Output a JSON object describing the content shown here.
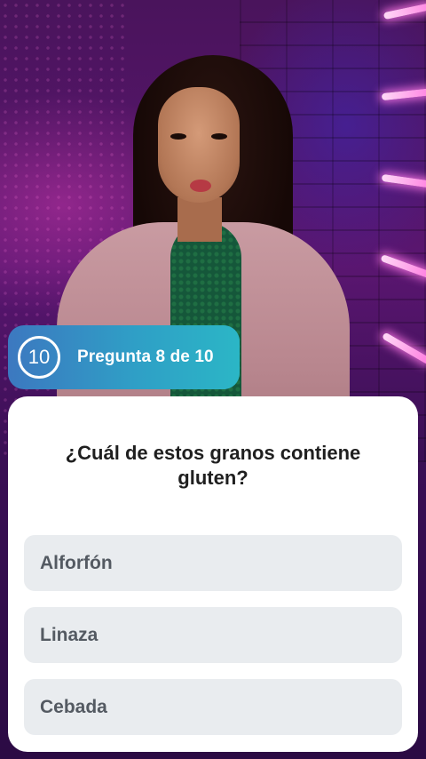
{
  "quiz": {
    "timer_value": "10",
    "progress_label": "Pregunta 8 de 10",
    "question": "¿Cuál de estos granos contiene gluten?",
    "options": [
      {
        "label": "Alforfón"
      },
      {
        "label": "Linaza"
      },
      {
        "label": "Cebada"
      }
    ]
  },
  "colors": {
    "badge_gradient_start": "#3c78c0",
    "badge_gradient_end": "#2bb6c6",
    "card_background": "#ffffff",
    "option_background": "#e9ecef",
    "option_text": "#545a62",
    "question_text": "#1f1f1f"
  }
}
